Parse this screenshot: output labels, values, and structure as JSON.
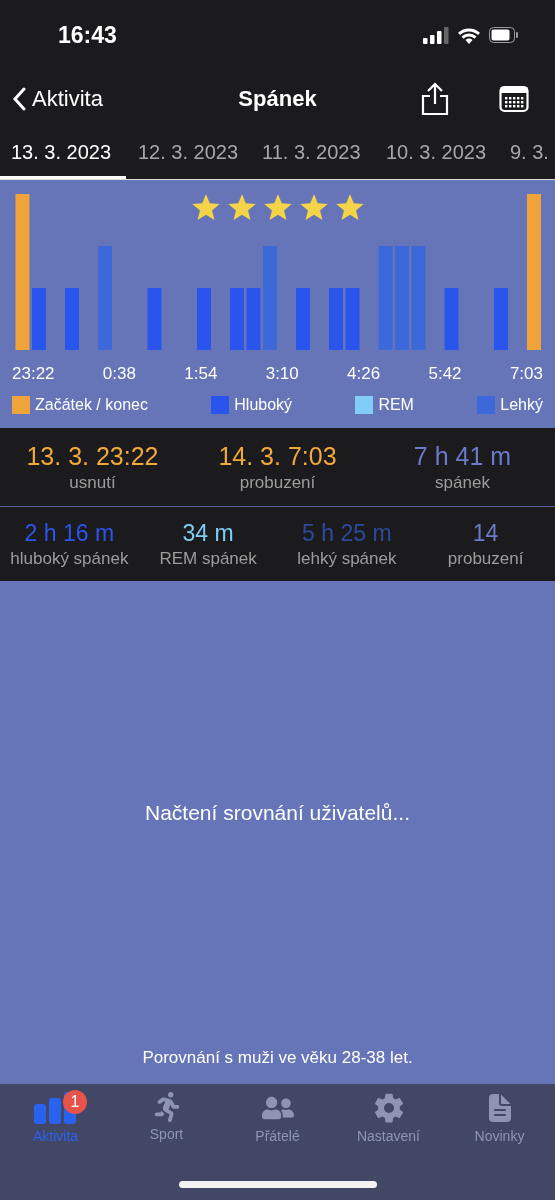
{
  "status_bar": {
    "time": "16:43"
  },
  "nav": {
    "back": "Aktivita",
    "title": "Spánek"
  },
  "date_tabs": [
    {
      "label": "13. 3. 2023",
      "selected": true
    },
    {
      "label": "12. 3. 2023",
      "selected": false
    },
    {
      "label": "11. 3. 2023",
      "selected": false
    },
    {
      "label": "10. 3. 2023",
      "selected": false
    },
    {
      "label": "9. 3.",
      "selected": false
    }
  ],
  "rating": {
    "stars": 5
  },
  "hypnogram": {
    "slots": [
      {
        "kind": "edge"
      },
      {
        "kind": "deep"
      },
      {
        "kind": "gap"
      },
      {
        "kind": "deep"
      },
      {
        "kind": "gap"
      },
      {
        "kind": "light"
      },
      {
        "kind": "gap"
      },
      {
        "kind": "gap"
      },
      {
        "kind": "deep"
      },
      {
        "kind": "gap"
      },
      {
        "kind": "gap"
      },
      {
        "kind": "deep"
      },
      {
        "kind": "gap"
      },
      {
        "kind": "deep"
      },
      {
        "kind": "deep"
      },
      {
        "kind": "light"
      },
      {
        "kind": "gap"
      },
      {
        "kind": "deep"
      },
      {
        "kind": "gap"
      },
      {
        "kind": "deep"
      },
      {
        "kind": "deep"
      },
      {
        "kind": "gap"
      },
      {
        "kind": "light"
      },
      {
        "kind": "light"
      },
      {
        "kind": "light"
      },
      {
        "kind": "gap"
      },
      {
        "kind": "deep"
      },
      {
        "kind": "gap"
      },
      {
        "kind": "gap"
      },
      {
        "kind": "deep"
      },
      {
        "kind": "gap"
      },
      {
        "kind": "edge"
      }
    ],
    "times": [
      "23:22",
      "0:38",
      "1:54",
      "3:10",
      "4:26",
      "5:42",
      "7:03"
    ]
  },
  "legend": [
    {
      "label": "Začátek / konec",
      "color": "#f0a33a"
    },
    {
      "label": "Hluboký",
      "color": "#2a55ec"
    },
    {
      "label": "REM",
      "color": "#82cdf7"
    },
    {
      "label": "Lehký",
      "color": "#3d68d9"
    }
  ],
  "summary": [
    {
      "value": "13. 3. 23:22",
      "label": "usnutí",
      "color": "#f2a93b"
    },
    {
      "value": "14. 3. 7:03",
      "label": "probuzení",
      "color": "#f2a93b"
    },
    {
      "value": "7 h 41 m",
      "label": "spánek",
      "color": "#6b79c8"
    }
  ],
  "phases": [
    {
      "value": "2 h 16 m",
      "label": "hluboký spánek",
      "color": "#2a55ec"
    },
    {
      "value": "34 m",
      "label": "REM spánek",
      "color": "#82cdf7"
    },
    {
      "value": "5 h 25 m",
      "label": "lehký spánek",
      "color": "#2c4a9c"
    },
    {
      "value": "14",
      "label": "probuzení",
      "color": "#6b79c8"
    }
  ],
  "comparison": {
    "message": "Načtení srovnání uživatelů...",
    "note": "Porovnání s muži ve věku 28-38 let."
  },
  "tab_bar": [
    {
      "kind": "activity",
      "label": "Aktivita",
      "selected": true,
      "badge": "1"
    },
    {
      "kind": "sport",
      "label": "Sport",
      "selected": false
    },
    {
      "kind": "friends",
      "label": "Přátelé",
      "selected": false
    },
    {
      "kind": "settings",
      "label": "Nastavení",
      "selected": false
    },
    {
      "kind": "news",
      "label": "Novinky",
      "selected": false
    }
  ]
}
